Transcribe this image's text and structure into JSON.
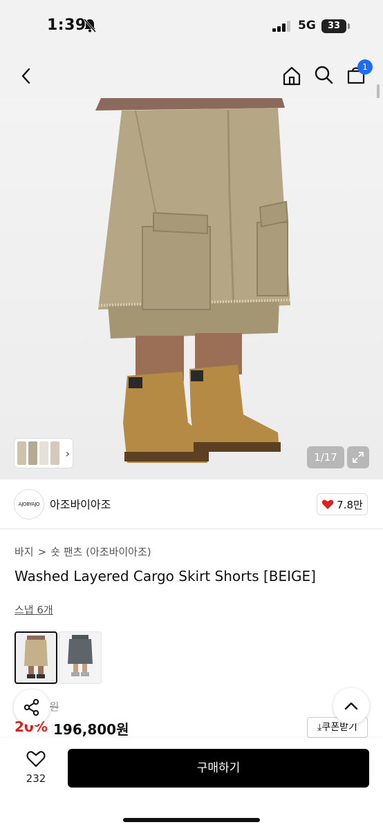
{
  "status_bar": {
    "time": "1:39",
    "network": "5G",
    "battery": "33"
  },
  "header": {
    "cart_count": "1"
  },
  "hero": {
    "counter": "1/17"
  },
  "brand": {
    "logo_text": "AJOBYAJO",
    "name": "아조바이아조",
    "likes": "7.8만"
  },
  "breadcrumb": {
    "category": "바지",
    "separator": ">",
    "subcategory": "숏 팬츠 (아조바이아조)"
  },
  "product": {
    "title": "Washed Layered Cargo Skirt Shorts [BEIGE]",
    "snap_link": "스냅 6개",
    "original_price": "0원",
    "discount": "20%",
    "price": "196,800원",
    "coupon_label": "⤓쿠폰받기"
  },
  "bottom_bar": {
    "wish_count": "232",
    "buy_label": "구매하기"
  },
  "colors": {
    "accent_red": "#e02020",
    "badge_blue": "#1d6cf2",
    "buy_bg": "#000000"
  },
  "icons": [
    "back-icon",
    "home-icon",
    "search-icon",
    "cart-icon",
    "expand-icon",
    "chevron-right-icon",
    "heart-icon",
    "share-icon",
    "chevron-up-icon",
    "bell-off-icon",
    "signal-icon",
    "battery-icon"
  ]
}
